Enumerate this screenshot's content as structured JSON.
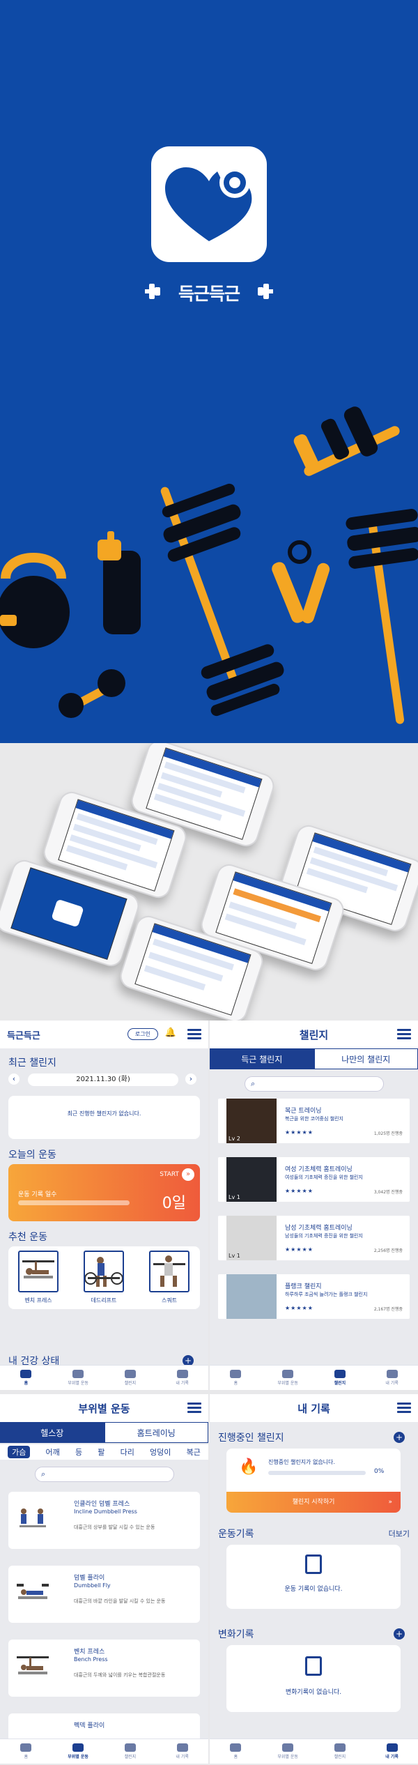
{
  "app": {
    "name": "득근득근"
  },
  "colors": {
    "primary": "#0e4aa6",
    "accent": "#f4a623",
    "navy": "#1c3f90",
    "gradient_start": "#f7a63a",
    "gradient_end": "#ef5b3b"
  },
  "home": {
    "logo": "득근득근",
    "login_button": "로그인",
    "recent_challenge_title": "최근 챌린지",
    "date": "2021.11.30 (화)",
    "no_challenge": "최근 진행한 챌린지가 없습니다.",
    "today_exercise_title": "오늘의 운동",
    "start_label": "START",
    "record_days_label": "운동 기록 일수",
    "record_days_value": "0일",
    "recommend_title": "추천 운동",
    "recommend": [
      "벤치 프레스",
      "데드리프트",
      "스쿼트"
    ],
    "health_title": "내 건강 상태"
  },
  "challenge": {
    "title": "챌린지",
    "tabs": [
      "득근 챌린지",
      "나만의 챌린지"
    ],
    "items": [
      {
        "name": "복근 트레이닝",
        "desc": "복근을 위한 코어중심 챌린지",
        "count": "1,025명 진행중",
        "level": "Lv 2",
        "stars": "★★★★★"
      },
      {
        "name": "여성 기초체력 홈트레이닝",
        "desc": "여성들의 기초체력 증진을 위한 챌린지",
        "count": "3,042명 진행중",
        "level": "Lv 1",
        "stars": "★★★★★"
      },
      {
        "name": "남성 기초체력 홈트레이닝",
        "desc": "남성들의 기초체력 증진을 위한 챌린지",
        "count": "2,256명 진행중",
        "level": "Lv 1",
        "stars": "★★★★★"
      },
      {
        "name": "플랭크 챌린지",
        "desc": "하루하루 조금씩 늘려가는 플랭크 챌린지",
        "count": "2,167명 진행중",
        "level": "",
        "stars": "★★★★★"
      }
    ]
  },
  "exercise": {
    "title": "부위별 운동",
    "tabs": [
      "헬스장",
      "홈트레이닝"
    ],
    "parts": [
      "가슴",
      "어깨",
      "등",
      "팔",
      "다리",
      "엉덩이",
      "복근"
    ],
    "items": [
      {
        "name": "인클라인 덤벨 프레스",
        "en": "Incline Dumbbell Press",
        "desc": "대흉근의 상부를 발달 시킬 수 있는 운동"
      },
      {
        "name": "덤벨 플라이",
        "en": "Dumbbell Fly",
        "desc": "대흉근의 바깥 라인을 발달 시킬 수 있는 운동"
      },
      {
        "name": "벤치 프레스",
        "en": "Bench Press",
        "desc": "대흉근의 두께와 넓이를 키우는 복합관절운동"
      },
      {
        "name": "펙덱 플라이",
        "en": "",
        "desc": ""
      }
    ]
  },
  "records": {
    "title": "내 기록",
    "in_progress_title": "진행중인 챌린지",
    "no_progress": "진행중인 챌린지가 없습니다.",
    "progress_pct": "0%",
    "start_challenge": "챌린지 시작하기",
    "exercise_record_title": "운동기록",
    "more": "더보기",
    "no_exercise_record": "운동 기록이 없습니다.",
    "change_record_title": "변화기록",
    "no_change_record": "변화기록이 없습니다."
  },
  "nav": [
    "홈",
    "부위별 운동",
    "챌린지",
    "내 기록"
  ]
}
